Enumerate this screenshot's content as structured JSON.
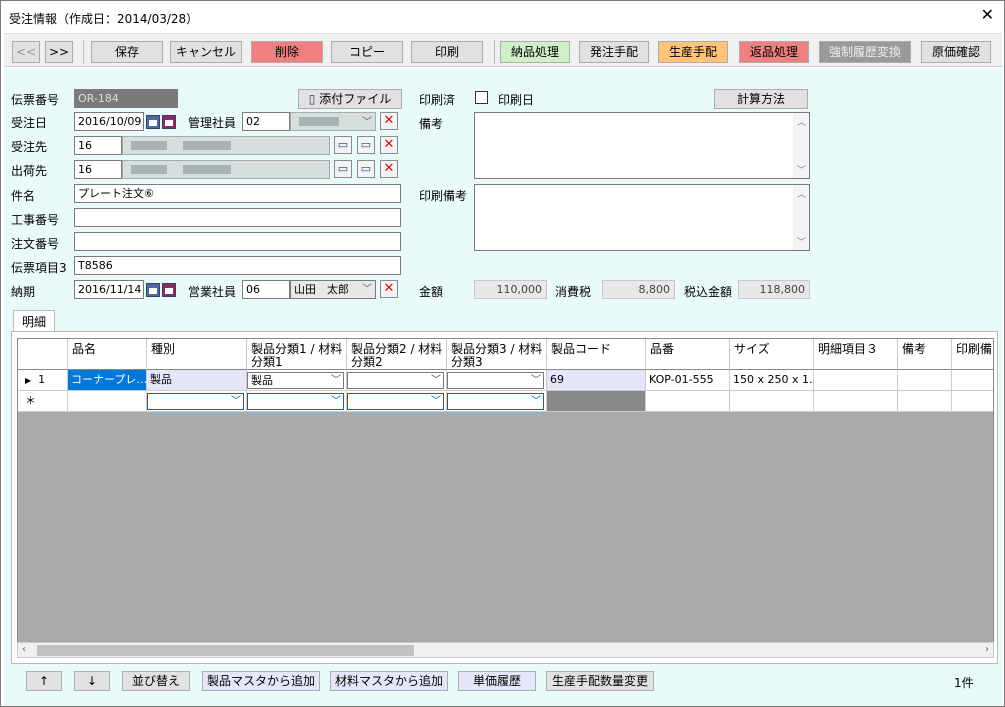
{
  "window": {
    "title": "受注情報（作成日：2014/03/28）",
    "close": "✕"
  },
  "toolbar": {
    "prev": "<<",
    "next": ">>",
    "save": "保存",
    "cancel": "キャンセル",
    "delete": "削除",
    "copy": "コピー",
    "print": "印刷",
    "delivery": "納品処理",
    "order": "発注手配",
    "production": "生産手配",
    "returns": "返品処理",
    "force_convert": "強制履歴変換",
    "cost_confirm": "原価確認"
  },
  "form": {
    "slip_no_label": "伝票番号",
    "slip_no": "OR-184",
    "attach_label": "添付ファイル",
    "order_date_label": "受注日",
    "order_date": "2016/10/09",
    "manager_label": "管理社員",
    "manager_code": "02",
    "customer_label": "受注先",
    "customer_code": "16",
    "ship_to_label": "出荷先",
    "ship_to_code": "16",
    "subject_label": "件名",
    "subject": "プレート注文⑥",
    "work_no_label": "工事番号",
    "work_no": "",
    "order_no_label": "注文番号",
    "order_no": "",
    "slip_item3_label": "伝票項目3",
    "slip_item3": "T8586",
    "due_label": "納期",
    "due_date": "2016/11/14",
    "sales_label": "営業社員",
    "sales_code": "06",
    "sales_name": "山田　太郎",
    "printed_label": "印刷済",
    "print_date_label": "印刷日",
    "calc_method": "計算方法",
    "remarks_label": "備考",
    "print_remarks_label": "印刷備考",
    "amount_label": "金額",
    "amount": "110,000",
    "tax_label": "消費税",
    "tax": "8,800",
    "total_label": "税込金額",
    "total": "118,800"
  },
  "tab": {
    "label": "明細"
  },
  "grid": {
    "columns": [
      "品名",
      "種別",
      "製品分類1 / 材料分類1",
      "製品分類2 / 材料分類2",
      "製品分類3 / 材料分類3",
      "製品コード",
      "品番",
      "サイズ",
      "明細項目３",
      "備考",
      "印刷備"
    ],
    "row1": {
      "no": "1",
      "name": "コーナープレ…",
      "kind": "製品",
      "cat1": "製品",
      "cat2": "",
      "cat3": "",
      "code": "69",
      "part": "KOP-01-555",
      "size": "150 x 250 x 1…"
    },
    "new_row_marker": "＊"
  },
  "bottom": {
    "up": "↑",
    "down": "↓",
    "sort": "並び替え",
    "add_product": "製品マスタから追加",
    "add_material": "材料マスタから追加",
    "price_history": "単価履歴",
    "change_qty": "生産手配数量変更",
    "count": "1件"
  }
}
